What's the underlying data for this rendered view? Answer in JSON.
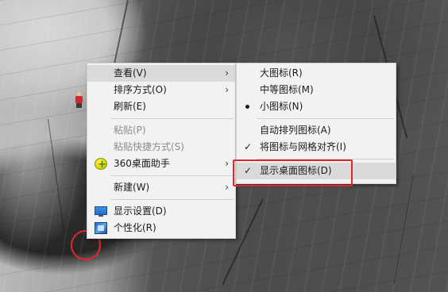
{
  "context_menu": {
    "items": [
      {
        "label": "查看(V)"
      },
      {
        "label": "排序方式(O)"
      },
      {
        "label": "刷新(E)"
      },
      {
        "label": "粘贴(P)"
      },
      {
        "label": "粘贴快捷方式(S)"
      },
      {
        "label": "360桌面助手",
        "icon": "360-icon"
      },
      {
        "label": "新建(W)"
      },
      {
        "label": "显示设置(D)",
        "icon": "display-settings-icon"
      },
      {
        "label": "个性化(R)",
        "icon": "personalize-icon"
      }
    ]
  },
  "view_submenu": {
    "items": [
      {
        "label": "大图标(R)"
      },
      {
        "label": "中等图标(M)"
      },
      {
        "label": "小图标(N)",
        "mark": "bullet"
      },
      {
        "label": "自动排列图标(A)"
      },
      {
        "label": "将图标与网格对齐(I)",
        "mark": "check"
      },
      {
        "label": "显示桌面图标(D)",
        "mark": "check"
      }
    ]
  },
  "glyphs": {
    "arrow": "›",
    "check": "✓"
  },
  "colors": {
    "highlight_annotation": "#e4262c",
    "menu_bg": "#f2f2f2",
    "hover_bg": "#dadada"
  }
}
